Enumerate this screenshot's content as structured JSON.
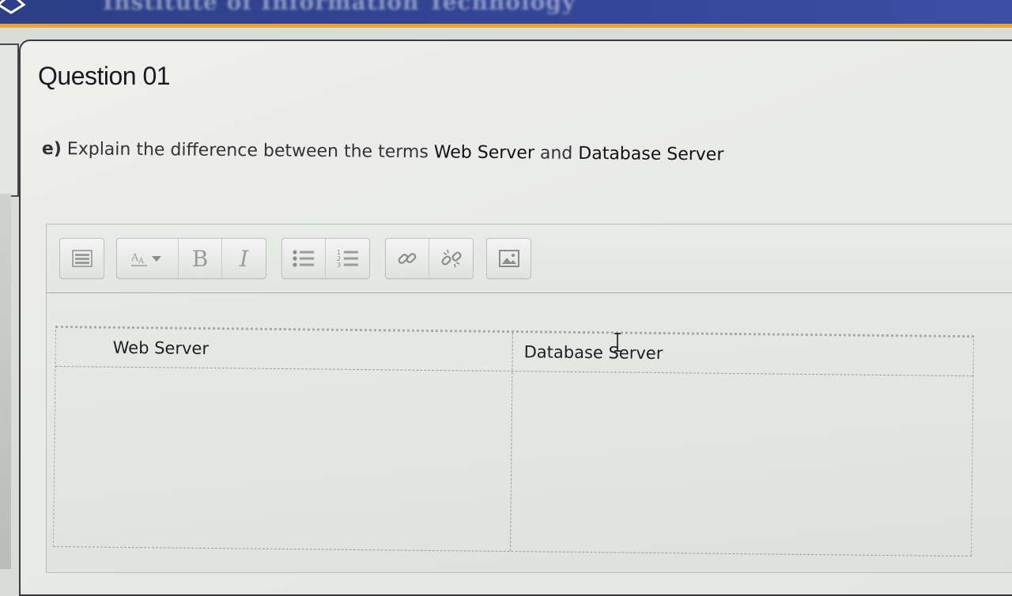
{
  "header": {
    "banner_text": "Institute of Information Technology"
  },
  "question": {
    "title": "Question 01",
    "prefix": "e)",
    "text_before": " Explain the difference between the terms ",
    "term1": "Web Server",
    "text_middle": " and ",
    "term2": "Database Server"
  },
  "toolbar": {
    "buttons": {
      "toggle": "toolbar-toggle-icon",
      "font_size": "font-size-icon",
      "bold": "B",
      "italic": "I",
      "unordered_list": "bullet-list-icon",
      "ordered_list": "numbered-list-icon",
      "link": "link-icon",
      "unlink": "unlink-icon",
      "image": "image-icon"
    }
  },
  "answer_table": {
    "columns": [
      "Web Server",
      "Database Server"
    ]
  },
  "colors": {
    "banner": "#33479a",
    "banner_accent": "#e0a43a"
  }
}
